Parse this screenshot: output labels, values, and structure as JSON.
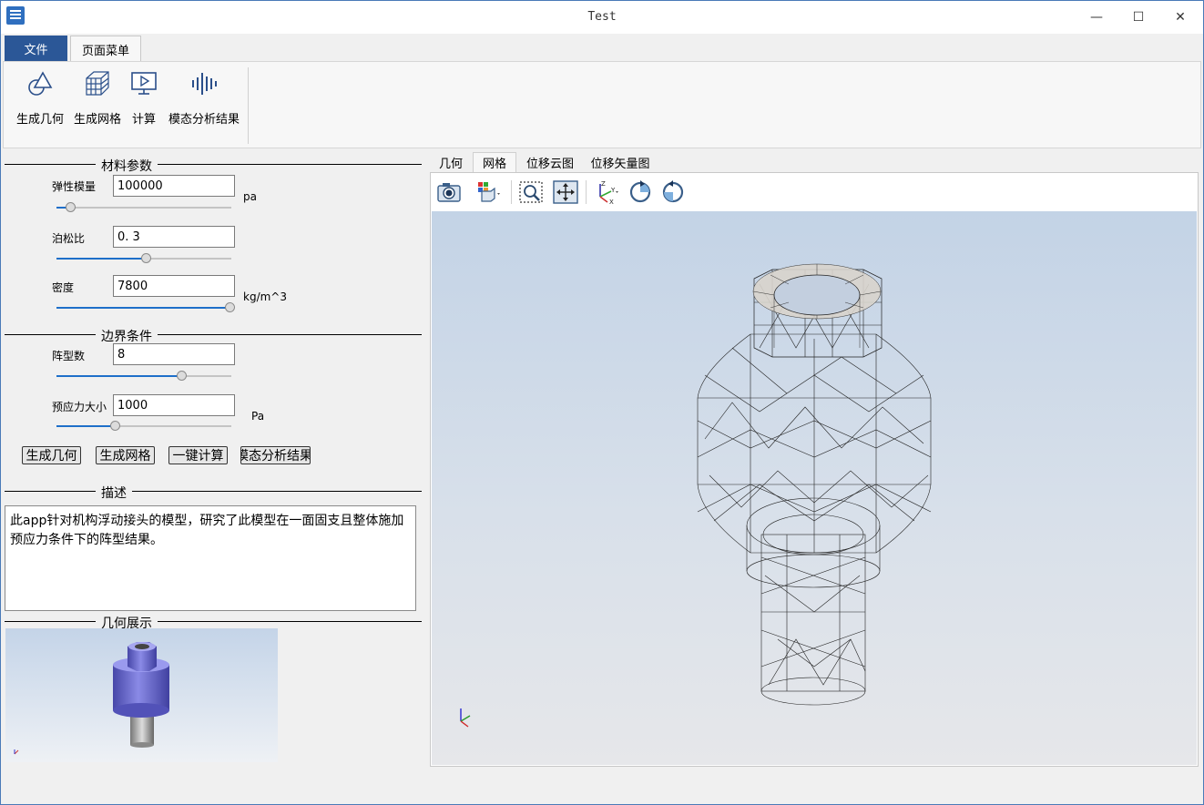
{
  "window": {
    "title": "Test",
    "min_glyph": "—",
    "max_glyph": "☐",
    "close_glyph": "✕"
  },
  "ribbon": {
    "tabs": [
      "文件",
      "页面菜单"
    ],
    "buttons": [
      {
        "label": "生成几何",
        "icon": "shapes-icon"
      },
      {
        "label": "生成网格",
        "icon": "mesh-cube-icon"
      },
      {
        "label": "计算",
        "icon": "monitor-play-icon"
      },
      {
        "label": "模态分析结果",
        "icon": "modal-wave-icon"
      }
    ]
  },
  "material": {
    "section_title": "材料参数",
    "params": [
      {
        "label": "弹性模量",
        "value": "100000",
        "unit": "pa",
        "slider_fraction": 0.07
      },
      {
        "label": "泊松比",
        "value": "0. 3",
        "unit": "",
        "slider_fraction": 0.51
      },
      {
        "label": "密度",
        "value": "7800",
        "unit": "kg/m^3",
        "slider_fraction": 1.0
      }
    ]
  },
  "boundary": {
    "section_title": "边界条件",
    "params": [
      {
        "label": "阵型数",
        "value": "8",
        "unit": "",
        "slider_fraction": 0.72
      },
      {
        "label": "预应力大小",
        "value": "1000",
        "unit": "Pa",
        "slider_fraction": 0.33
      }
    ]
  },
  "actions": [
    "生成几何",
    "生成网格",
    "一键计算",
    "模态分析结果"
  ],
  "description": {
    "section_title": "描述",
    "text": "此app针对机构浮动接头的模型，研究了此模型在一面固支且整体施加预应力条件下的阵型结果。"
  },
  "geometry_preview": {
    "section_title": "几何展示"
  },
  "viewer": {
    "tabs": [
      "几何",
      "网格",
      "位移云图",
      "位移矢量图"
    ],
    "active_tab": "网格",
    "toolbar": [
      "camera-icon",
      "display-mode-icon",
      "zoom-box-icon",
      "fit-view-icon",
      "axes-icon",
      "rotate-cw-icon",
      "rotate-ccw-icon"
    ]
  },
  "colors": {
    "accent": "#2b5797",
    "slider_fill": "#1e6fc9",
    "preview_model": "#6f6fd0"
  }
}
